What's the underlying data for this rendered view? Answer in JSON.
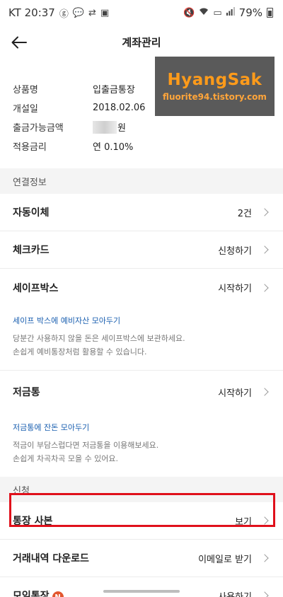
{
  "status_bar": {
    "carrier_time": "KT 20:37",
    "battery": "79%"
  },
  "header": {
    "title": "계좌관리",
    "back_icon": "arrow-left-icon"
  },
  "watermark": {
    "title": "HyangSak",
    "url": "fluorite94.tistory.com"
  },
  "account_info": [
    {
      "label": "상품명",
      "value": "입출금통장"
    },
    {
      "label": "개설일",
      "value": "2018.02.06"
    },
    {
      "label": "출금가능금액",
      "value": "원"
    },
    {
      "label": "적용금리",
      "value": "연 0.10%"
    }
  ],
  "sections": {
    "linked": "연결정보",
    "apply": "신청"
  },
  "linked_items": [
    {
      "label": "자동이체",
      "value": "2건"
    },
    {
      "label": "체크카드",
      "value": "신청하기"
    },
    {
      "label": "세이프박스",
      "value": "시작하기"
    }
  ],
  "safebox_promo": {
    "title": "세이프 박스에 예비자산 모아두기",
    "line1": "당분간 사용하지 않을 돈은 세이프박스에 보관하세요.",
    "line2": "손쉽게 예비통장처럼 활용할 수 있습니다."
  },
  "piggy": {
    "label": "저금통",
    "value": "시작하기"
  },
  "piggy_promo": {
    "title": "저금통에 잔돈 모아두기",
    "line1": "적금이 부담스럽다면 저금통을 이용해보세요.",
    "line2": "손쉽게 차곡차곡 모을 수 있어요."
  },
  "apply_items": [
    {
      "label": "통장 사본",
      "value": "보기"
    },
    {
      "label": "거래내역 다운로드",
      "value": "이메일로 받기"
    },
    {
      "label": "모임통장",
      "value": "사용하기",
      "badge": "N"
    }
  ],
  "colors": {
    "highlight": "#e0101b",
    "promo_title": "#1a5fb0",
    "watermark_bg": "#5a5a5a",
    "watermark_text": "#ff9b1a"
  }
}
